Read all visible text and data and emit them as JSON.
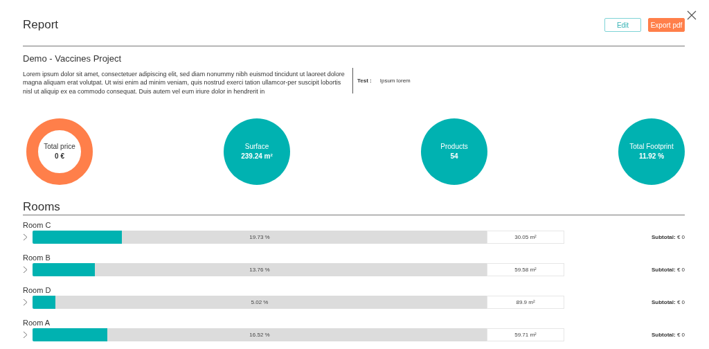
{
  "header": {
    "title": "Report",
    "buttons": [
      {
        "label": "Edit",
        "kind": "outline"
      },
      {
        "label": "Export pdf",
        "kind": "filled"
      }
    ]
  },
  "project": {
    "name": "Demo - Vaccines Project",
    "description": "Lorem ipsum dolor sit amet, consectetuer adipiscing elit, sed diam nonummy nibh euismod tincidunt ut laoreet dolore magna aliquam erat volutpat. Ut wisi enim ad minim veniam, quis nostrud exerci tation ullamcor-per suscipit lobortis nisl ut aliquip ex ea commodo consequat. Duis autem vel eum iriure dolor in hendrerit in",
    "fields": [
      {
        "label": "Test :",
        "value": "Ipsum lorem"
      }
    ]
  },
  "stats": [
    {
      "kind": "ring",
      "label": "Total price",
      "value": "0 €"
    },
    {
      "kind": "filled",
      "label": "Surface",
      "value": "239.24 m²"
    },
    {
      "kind": "filled",
      "label": "Products",
      "value": "54"
    },
    {
      "kind": "filled",
      "label": "Total Footprint",
      "value": "11.92 %"
    }
  ],
  "rooms": {
    "title": "Rooms",
    "items": [
      {
        "name": "Room C",
        "level": 0.1973,
        "percent": "19.73 %",
        "area": "30.05 m²",
        "subtotal": "**Subtotal:** € 0"
      },
      {
        "name": "Room B",
        "level": 0.1376,
        "percent": "13.76 %",
        "area": "59.58 m²",
        "subtotal": "**Subtotal:** € 0"
      },
      {
        "name": "Room D",
        "level": 0.0502,
        "percent": "5.02 %",
        "area": "89.9 m²",
        "subtotal": "**Subtotal:** € 0"
      },
      {
        "name": "Room A",
        "level": 0.1652,
        "percent": "16.52 %",
        "area": "59.71 m²",
        "subtotal": "**Subtotal:** € 0"
      }
    ]
  }
}
